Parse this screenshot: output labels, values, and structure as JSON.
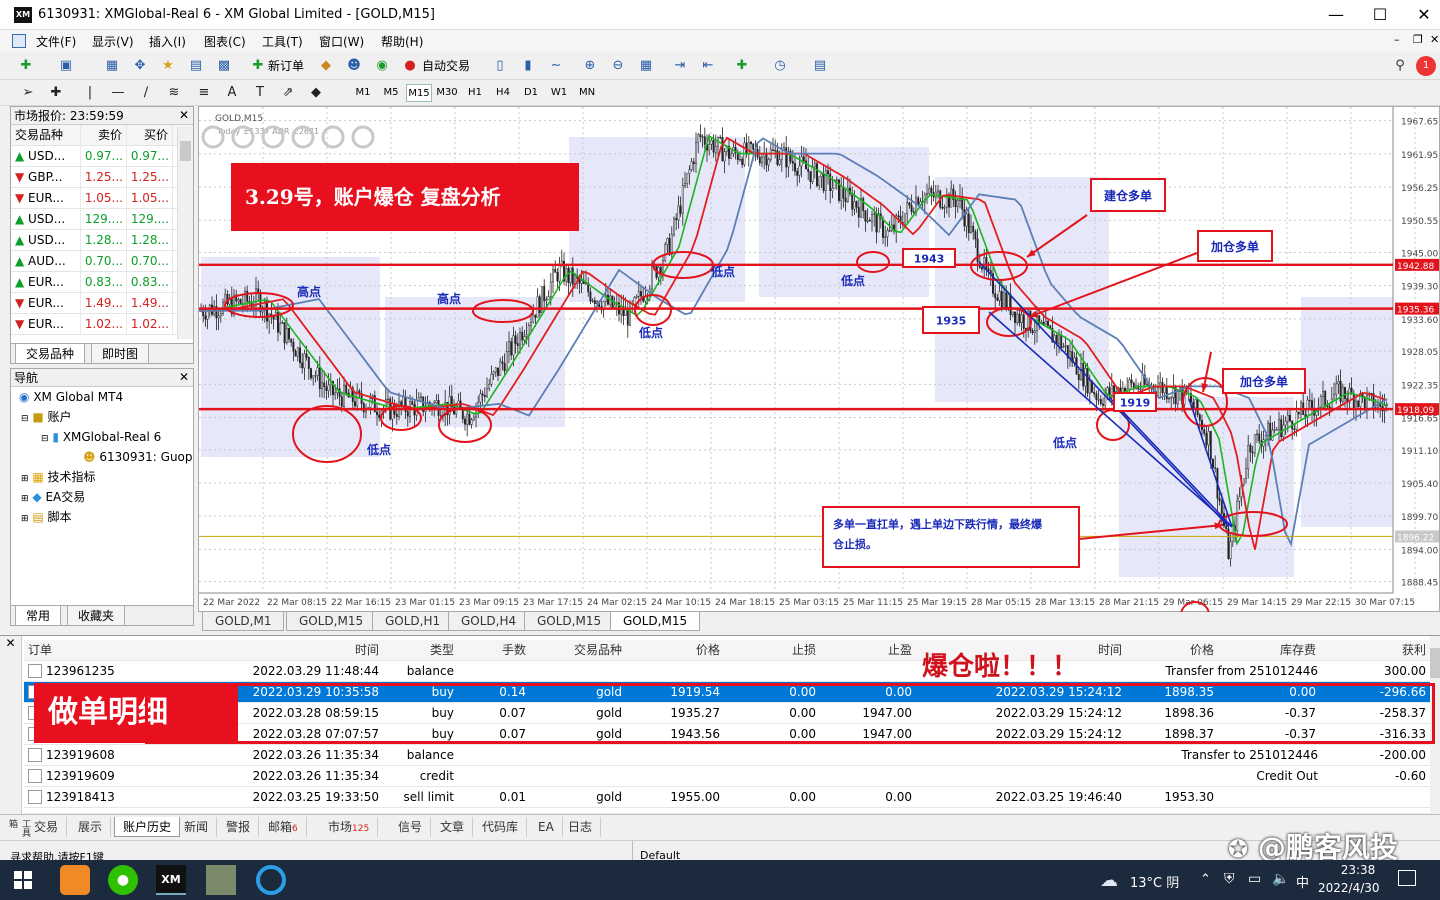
{
  "window": {
    "title": "6130931: XMGlobal-Real 6 - XM Global Limited - [GOLD,M15]",
    "logo": "XM"
  },
  "menu": [
    "文件(F)",
    "显示(V)",
    "插入(I)",
    "图表(C)",
    "工具(T)",
    "窗口(W)",
    "帮助(H)"
  ],
  "toolbar": {
    "new_order": "新订单",
    "auto_trading": "自动交易",
    "timeframes": [
      "M1",
      "M5",
      "M15",
      "M30",
      "H1",
      "H4",
      "D1",
      "W1",
      "MN"
    ],
    "active_tf": "M15"
  },
  "market_watch": {
    "title": "市场报价: 23:59:59",
    "headers": [
      "交易品种",
      "卖价",
      "买价"
    ],
    "rows": [
      {
        "dir": "up",
        "symbol": "USD...",
        "bid": "0.97...",
        "ask": "0.97..."
      },
      {
        "dir": "dn",
        "symbol": "GBP...",
        "bid": "1.25...",
        "ask": "1.25..."
      },
      {
        "dir": "dn",
        "symbol": "EUR...",
        "bid": "1.05...",
        "ask": "1.05..."
      },
      {
        "dir": "up",
        "symbol": "USD...",
        "bid": "129....",
        "ask": "129...."
      },
      {
        "dir": "up",
        "symbol": "USD...",
        "bid": "1.28...",
        "ask": "1.28..."
      },
      {
        "dir": "up",
        "symbol": "AUD...",
        "bid": "0.70...",
        "ask": "0.70..."
      },
      {
        "dir": "up",
        "symbol": "EUR...",
        "bid": "0.83...",
        "ask": "0.83..."
      },
      {
        "dir": "dn",
        "symbol": "EUR...",
        "bid": "1.49...",
        "ask": "1.49..."
      },
      {
        "dir": "dn",
        "symbol": "EUR...",
        "bid": "1.02...",
        "ask": "1.02..."
      }
    ],
    "tabs": [
      "交易品种",
      "即时图"
    ]
  },
  "navigator": {
    "title": "导航",
    "root": "XM Global MT4",
    "accounts": "账户",
    "server": "XMGlobal-Real 6",
    "account": "6130931: Guop",
    "indicators": "技术指标",
    "ea": "EA交易",
    "scripts": "脚本",
    "tabs": [
      "常用",
      "收藏夹"
    ]
  },
  "chart": {
    "symbol": "GOLD,M15",
    "ohlc_hint": "Today ±1337 ADR ±2631",
    "ohlc_buttons": [
      "D",
      "W",
      "Mo",
      "3Y",
      "1Y",
      "D"
    ],
    "price_ticks": [
      "1967.65",
      "1961.95",
      "1956.25",
      "1950.55",
      "1945.00",
      "1939.30",
      "1933.60",
      "1928.05",
      "1922.35",
      "1916.65",
      "1911.10",
      "1905.40",
      "1899.70",
      "1894.00",
      "1888.45"
    ],
    "price_tags": [
      "1942.88",
      "1935.36",
      "1918.09",
      "1896.22"
    ],
    "time_ticks": [
      "22 Mar 2022",
      "22 Mar 08:15",
      "22 Mar 16:15",
      "23 Mar 01:15",
      "23 Mar 09:15",
      "23 Mar 17:15",
      "24 Mar 02:15",
      "24 Mar 10:15",
      "24 Mar 18:15",
      "25 Mar 03:15",
      "25 Mar 11:15",
      "25 Mar 19:15",
      "28 Mar 05:15",
      "28 Mar 13:15",
      "28 Mar 21:15",
      "29 Mar 06:15",
      "29 Mar 14:15",
      "29 Mar 22:15",
      "30 Mar 07:15"
    ],
    "headline": "3.29号，账户爆仓 复盘分析",
    "labels": {
      "high1": "高点",
      "high2": "高点",
      "low1": "低点",
      "low2": "低点",
      "low3": "低点",
      "low4": "低点",
      "low5": "低点",
      "open_long": "建仓多单",
      "add_long1": "加仓多单",
      "add_long2": "加仓多单",
      "p1943": "1943",
      "p1935": "1935",
      "p1919": "1919",
      "note": "多单一直扛单，遇上单边下跌行情，最终爆仓止损。"
    },
    "tabs": [
      "GOLD,M1",
      "GOLD,M15",
      "GOLD,H1",
      "GOLD,H4",
      "GOLD,M15",
      "GOLD,M15"
    ],
    "active_tab": 5
  },
  "terminal": {
    "headers": [
      "订单",
      "时间",
      "类型",
      "手数",
      "交易品种",
      "价格",
      "止损",
      "止盈",
      "时间",
      "价格",
      "库存费",
      "获利"
    ],
    "rows": [
      {
        "order": "123961235",
        "time": "2022.03.29 11:48:44",
        "type": "balance",
        "lots": "",
        "sym": "",
        "price": "",
        "sl": "",
        "tp": "",
        "ctime": "",
        "cprice": "Transfer from 251012446",
        "swap": "",
        "profit": "300.00"
      },
      {
        "order": "",
        "time": "2022.03.29 10:35:58",
        "type": "buy",
        "lots": "0.14",
        "sym": "gold",
        "price": "1919.54",
        "sl": "0.00",
        "tp": "0.00",
        "ctime": "2022.03.29 15:24:12",
        "cprice": "1898.35",
        "swap": "0.00",
        "profit": "-296.66"
      },
      {
        "order": "",
        "time": "2022.03.28 08:59:15",
        "type": "buy",
        "lots": "0.07",
        "sym": "gold",
        "price": "1935.27",
        "sl": "0.00",
        "tp": "1947.00",
        "ctime": "2022.03.29 15:24:12",
        "cprice": "1898.36",
        "swap": "-0.37",
        "profit": "-258.37"
      },
      {
        "order": "",
        "time": "2022.03.28 07:07:57",
        "type": "buy",
        "lots": "0.07",
        "sym": "gold",
        "price": "1943.56",
        "sl": "0.00",
        "tp": "1947.00",
        "ctime": "2022.03.29 15:24:12",
        "cprice": "1898.37",
        "swap": "-0.37",
        "profit": "-316.33"
      },
      {
        "order": "123919608",
        "time": "2022.03.26 11:35:34",
        "type": "balance",
        "lots": "",
        "sym": "",
        "price": "",
        "sl": "",
        "tp": "",
        "ctime": "",
        "cprice": "Transfer to 251012446",
        "swap": "",
        "profit": "-200.00"
      },
      {
        "order": "123919609",
        "time": "2022.03.26 11:35:34",
        "type": "credit",
        "lots": "",
        "sym": "",
        "price": "",
        "sl": "",
        "tp": "",
        "ctime": "",
        "cprice": "Credit Out",
        "swap": "",
        "profit": "-0.60"
      },
      {
        "order": "123918413",
        "time": "2022.03.25 19:33:50",
        "type": "sell limit",
        "lots": "0.01",
        "sym": "gold",
        "price": "1955.00",
        "sl": "0.00",
        "tp": "0.00",
        "ctime": "2022.03.25 19:46:40",
        "cprice": "1953.30",
        "swap": "",
        "profit": ""
      }
    ],
    "selected_row": 1,
    "details_label": "做单明细",
    "blowup_label": "爆仓啦！！！",
    "tabs": [
      "交易",
      "展示",
      "账户历史",
      "新闻",
      "警报",
      "邮箱",
      "市场",
      "信号",
      "文章",
      "代码库",
      "EA",
      "日志"
    ],
    "active_tab": 2,
    "mail_badge": "6",
    "market_badge": "125"
  },
  "statusbar": {
    "help": "寻求帮助,请按F1键",
    "profile": "Default"
  },
  "watermark": "@鹏客风投",
  "taskbar": {
    "weather": "13°C 阴",
    "ime": "中",
    "time": "23:38",
    "date": "2022/4/30"
  }
}
